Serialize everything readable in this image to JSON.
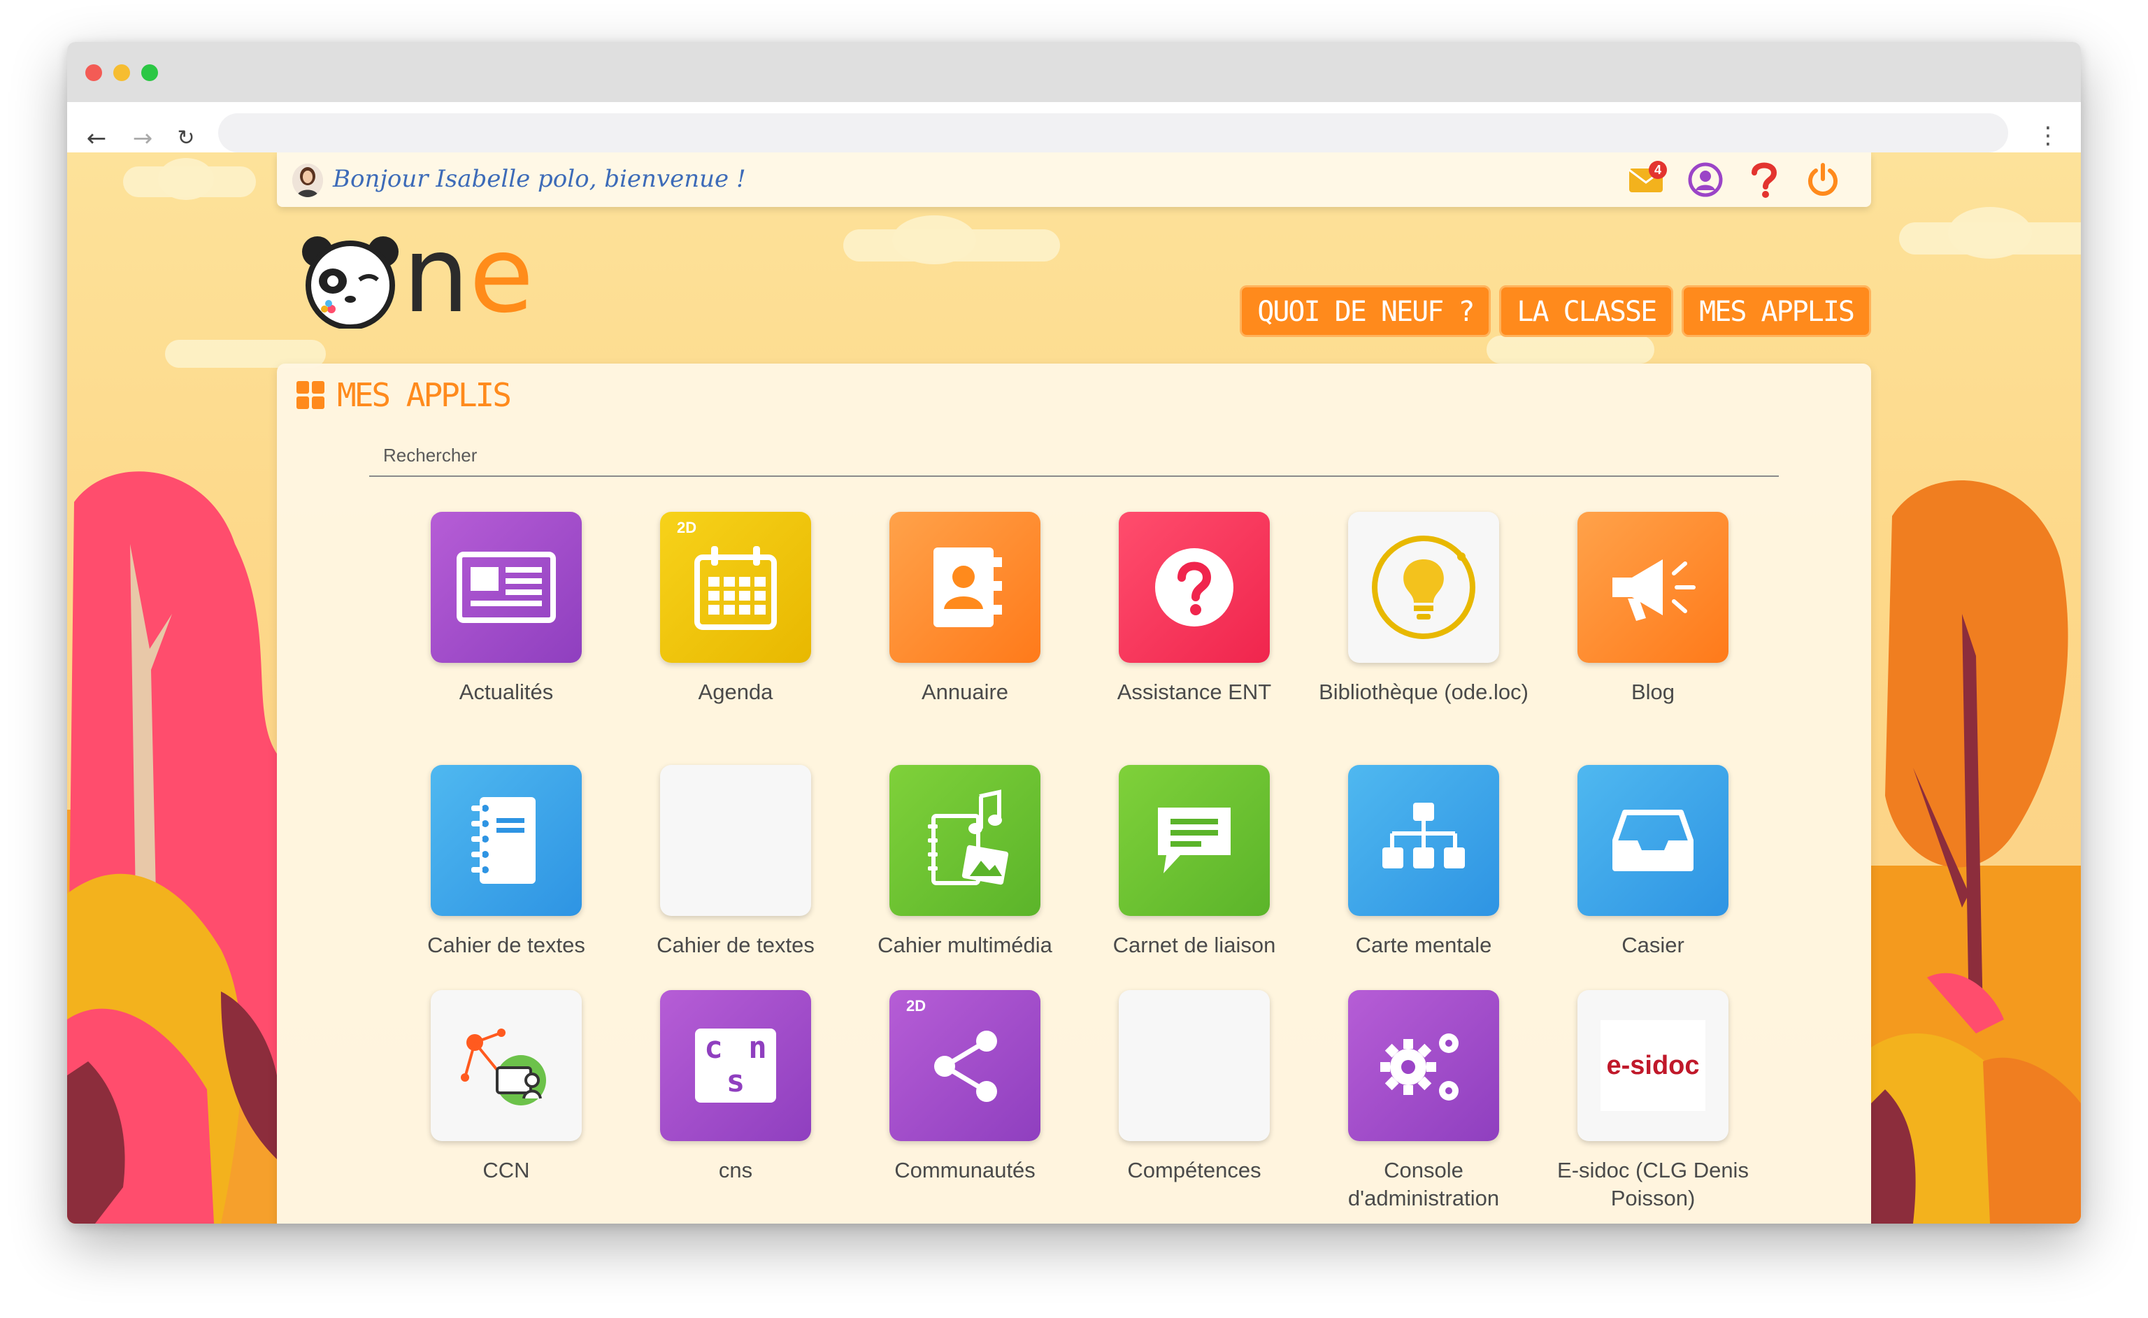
{
  "greeting": {
    "text": "Bonjour Isabelle polo, bienvenue !"
  },
  "notifications": {
    "count": "4"
  },
  "logo": {
    "text_n": "n",
    "text_e": "e"
  },
  "nav": [
    {
      "label": "QUOI DE NEUF ?"
    },
    {
      "label": "LA CLASSE"
    },
    {
      "label": "MES APPLIS"
    }
  ],
  "panel": {
    "title": "MES APPLIS"
  },
  "search": {
    "label": "Rechercher"
  },
  "apps": [
    {
      "label": "Actualités"
    },
    {
      "label": "Agenda",
      "tag": "2D"
    },
    {
      "label": "Annuaire"
    },
    {
      "label": "Assistance ENT"
    },
    {
      "label": "Bibliothèque (ode.loc)"
    },
    {
      "label": "Blog"
    },
    {
      "label": "Cahier de textes"
    },
    {
      "label": "Cahier de textes"
    },
    {
      "label": "Cahier multimédia"
    },
    {
      "label": "Carnet de liaison"
    },
    {
      "label": "Carte mentale"
    },
    {
      "label": "Casier"
    },
    {
      "label": "CCN"
    },
    {
      "label": "cns",
      "tile_text": "c n s"
    },
    {
      "label": "Communautés",
      "tag": "2D"
    },
    {
      "label": "Compétences"
    },
    {
      "label": "Console d'administration"
    },
    {
      "label": "E-sidoc (CLG Denis Poisson)",
      "tile_text": "e-sidoc"
    }
  ],
  "colors": {
    "accent": "#ff8a1c",
    "greeting_text": "#3d6bb8",
    "badge": "#e3342f"
  }
}
